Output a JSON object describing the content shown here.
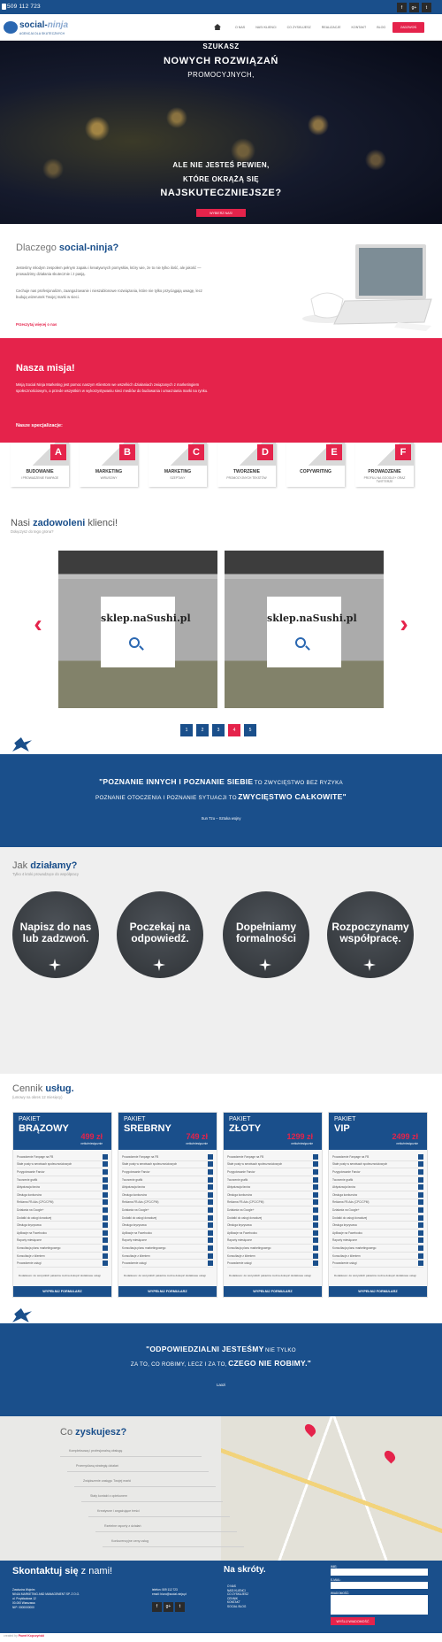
{
  "topbar": {
    "phone": "509 112 723",
    "socials": [
      "f",
      "g+",
      "t"
    ]
  },
  "nav": {
    "logo_main": "social-",
    "logo_accent": "ninja",
    "logo_sub": "AGENCJA DLA SKUTECZNYCH",
    "items": [
      "O NAS",
      "NASI KLIENCI",
      "CO ZYSKUJESZ",
      "REALIZACJE",
      "KONTAKT",
      "BLOG"
    ],
    "cta": "ZADZWOŃ"
  },
  "hero": {
    "line1": "SZUKASZ",
    "line2": "NOWYCH ROZWIĄZAŃ",
    "line3": "PROMOCYJNYCH,",
    "line4": "ALE NIE JESTEŚ PEWIEN,",
    "line5": "KTÓRE OKRĄŻĄ SIĘ",
    "line6": "NAJSKUTECZNIEJSZE?",
    "button": "WYBIERZ NAS!"
  },
  "why": {
    "title_plain": "Dlaczego",
    "title_bold": "social-ninja?",
    "p1": "Jesteśmy młodym zespołem pełnym zapału i kreatywnych pomysłów, który wie, że to nie tylko ilość, ale jakość — prowadzimy działania skutecznie i z pasją.",
    "p2": "Cechuje nas profesjonalizm, zaangażowanie i nieszablonowe rozwiązania, które nie tylko przyciągają uwagę, lecz budują wizerunek Twojej marki w sieci.",
    "link": "Przeczytaj więcej o nas"
  },
  "mission": {
    "title": "Nasza misja!",
    "text": "Misją Social Ninja Marketing jest pomoc naszym Klientom we wszelkich działaniach związanych z marketingiem społecznościowym, a przede wszystkim w wykorzystywaniu sieci mediów do budowania i umacniania marki na rynku.",
    "spec_title": "Nasze specjalizacje:",
    "specs": [
      {
        "letter": "A",
        "title": "BUDOWANIE",
        "sub": "I PROWADZENIE FANPAGE"
      },
      {
        "letter": "B",
        "title": "MARKETING",
        "sub": "WIRUSOWY"
      },
      {
        "letter": "C",
        "title": "MARKETING",
        "sub": "SZEPTANY"
      },
      {
        "letter": "D",
        "title": "TWORZENIE",
        "sub": "PROMOCYJNYCH TEKSTÓW"
      },
      {
        "letter": "E",
        "title": "COPYWRITING",
        "sub": ""
      },
      {
        "letter": "F",
        "title": "PROWADZENIE",
        "sub": "PROFILU NA GOOGLE+ ORAZ TWITTERZE"
      }
    ]
  },
  "clients": {
    "title_plain": "Nasi",
    "title_bold": "zadowoleni",
    "title_end": "klienci!",
    "sub": "Dołączysz do tego grona?",
    "slides": [
      "sklep.naSushi.pl",
      "sklep.naSushi.pl"
    ],
    "pages": [
      "1",
      "2",
      "3",
      "4",
      "5"
    ]
  },
  "quote1": {
    "l1a": "\"POZNANIE INNYCH I POZNANIE SIEBIE",
    "l1b": "TO ZWYCIĘSTWO BEZ RYZYKA",
    "l2a": "POZNANIE OTOCZENIA I POZNANIE SYTUACJI TO",
    "l2b": "ZWYCIĘSTWO CAŁKOWITE\"",
    "author": "Sun Tzu – Sztuka wojny"
  },
  "how": {
    "title_plain": "Jak",
    "title_bold": "działamy?",
    "sub": "Tylko 4 kroki prowadzące do współpracy",
    "steps": [
      "Napisz do nas lub zadzwoń.",
      "Poczekaj na odpowiedź.",
      "Dopełniamy formalności",
      "Rozpoczynamy współpracę."
    ]
  },
  "pricing": {
    "title_plain": "Cennik",
    "title_bold": "usług.",
    "sub": "(umowy na okres 12 miesięcy)",
    "package_label": "PAKIET",
    "period": "netto/miesięcznie",
    "button": "WYPEŁNIJ FORMULARZ",
    "plans": [
      {
        "name": "BRĄZOWY",
        "price": "499 zł"
      },
      {
        "name": "SREBRNY",
        "price": "749 zł"
      },
      {
        "name": "ZŁOTY",
        "price": "1299 zł"
      },
      {
        "name": "VIP",
        "price": "2499 zł"
      }
    ],
    "features": [
      "Prowadzenie Fanpage na FB",
      "Stałe posty w serwisach społecznościowych",
      "Przygotowanie Fanów",
      "Tworzenie grafik",
      "Aktywizacja fanów",
      "Obsługa konkursów",
      "Reklama FB Ads (CPC/CPM)",
      "Działania na Google+",
      "Dodatki do usługi doradczej",
      "Obsługa kryzysowa",
      "Aplikacje na Facebooku",
      "Raporty miesięczne",
      "Konsultacja planu marketingowego",
      "Konsultacje z klientem",
      "Prowadzenie usługi"
    ],
    "note": "Dodatkowo: do wszystkich pakietów można dokupić dodatkowe usługi"
  },
  "quote2": {
    "l1a": "\"ODPOWIEDZIALNI JESTEŚMY",
    "l1b": "NIE TYLKO",
    "l2a": "ZA TO, CO ROBIMY, LECZ I ZA TO,",
    "l2b": "CZEGO NIE ROBIMY.\"",
    "author": "Laozi"
  },
  "gain": {
    "title_plain": "Co",
    "title_bold": "zyskujesz?",
    "items": [
      "Kompleksową i profesjonalną obsługę",
      "Przemyślaną strategię działań",
      "Zwiększenie zasięgu Twojej marki",
      "Stały kontakt z opiekunem",
      "Kreatywne i angażujące treści",
      "Rzetelne raporty z działań",
      "Konkurencyjne ceny usług"
    ]
  },
  "footer": {
    "title_bold": "Skontaktuj się",
    "title_plain": "z nami!",
    "address": [
      "Zawiszów Wojnim",
      "NINJA MARKETING AND MANAGEMENT SP. Z O.O.",
      "ul. Przykładowa 12",
      "00-000 Warszawa",
      "NIP: 0000000000"
    ],
    "contact": [
      "telefon: 509 112 723",
      "email: biuro@social-ninja.pl"
    ],
    "shortcuts_title": "Na skróty.",
    "shortcuts": [
      "O NAS",
      "NASI KLIENCI",
      "CO ZYSKUJESZ",
      "CENNIK",
      "KONTAKT",
      "SOCIAL BLOG"
    ],
    "form_labels": [
      "IMIĘ:",
      "E-MAIL:",
      "WIADOMOŚĆ:"
    ],
    "send": "WYŚLIJ WIADOMOŚĆ",
    "credit_plain": "created by",
    "credit_bold": "Paweł Kopczyński"
  }
}
